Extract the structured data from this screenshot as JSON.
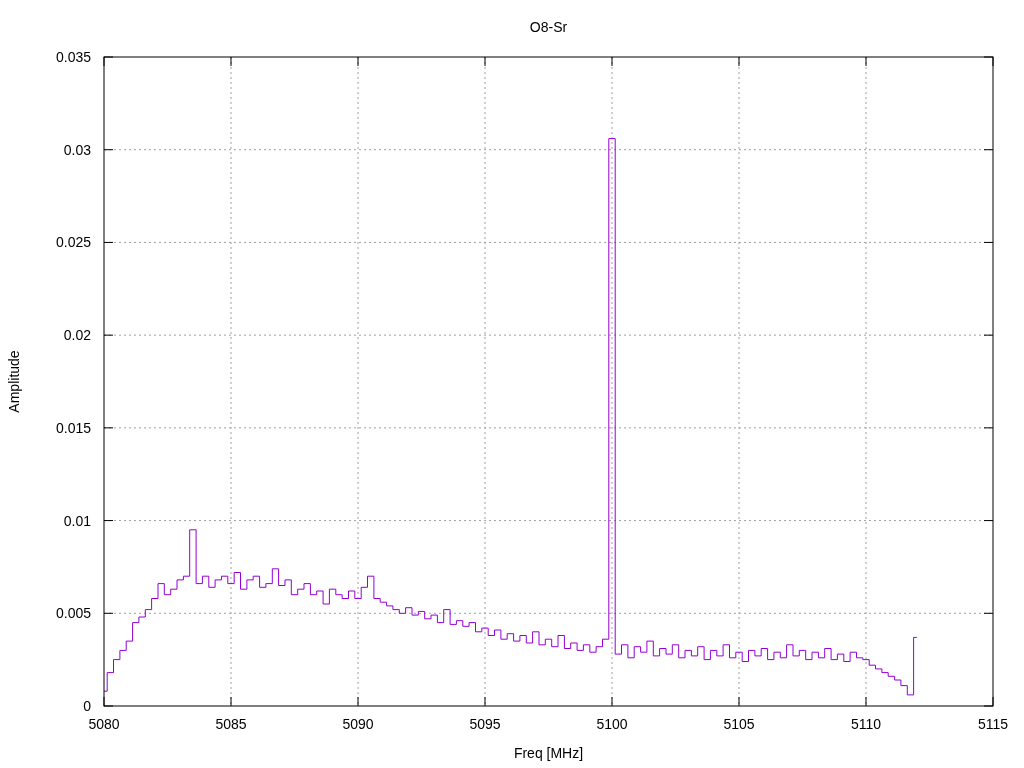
{
  "chart_data": {
    "type": "line",
    "title": "O8-Sr",
    "xlabel": "Freq [MHz]",
    "ylabel": "Amplitude",
    "x": [
      5080,
      5080.25,
      5080.5,
      5080.75,
      5081,
      5081.25,
      5081.5,
      5081.75,
      5082,
      5082.25,
      5082.5,
      5082.75,
      5083,
      5083.25,
      5083.5,
      5083.75,
      5084,
      5084.25,
      5084.5,
      5084.75,
      5085,
      5085.25,
      5085.5,
      5085.75,
      5086,
      5086.25,
      5086.5,
      5086.75,
      5087,
      5087.25,
      5087.5,
      5087.75,
      5088,
      5088.25,
      5088.5,
      5088.75,
      5089,
      5089.25,
      5089.5,
      5089.75,
      5090,
      5090.25,
      5090.5,
      5090.75,
      5091,
      5091.25,
      5091.5,
      5091.75,
      5092,
      5092.25,
      5092.5,
      5092.75,
      5093,
      5093.25,
      5093.5,
      5093.75,
      5094,
      5094.25,
      5094.5,
      5094.75,
      5095,
      5095.25,
      5095.5,
      5095.75,
      5096,
      5096.25,
      5096.5,
      5096.75,
      5097,
      5097.25,
      5097.5,
      5097.75,
      5098,
      5098.25,
      5098.5,
      5098.75,
      5099,
      5099.25,
      5099.5,
      5099.75,
      5100,
      5100.25,
      5100.5,
      5100.75,
      5101,
      5101.25,
      5101.5,
      5101.75,
      5102,
      5102.25,
      5102.5,
      5102.75,
      5103,
      5103.25,
      5103.5,
      5103.75,
      5104,
      5104.25,
      5104.5,
      5104.75,
      5105,
      5105.25,
      5105.5,
      5105.75,
      5106,
      5106.25,
      5106.5,
      5106.75,
      5107,
      5107.25,
      5107.5,
      5107.75,
      5108,
      5108.25,
      5108.5,
      5108.75,
      5109,
      5109.25,
      5109.5,
      5109.75,
      5110,
      5110.25,
      5110.5,
      5110.75,
      5111,
      5111.25,
      5111.5,
      5111.75,
      5112
    ],
    "series": [
      {
        "color": "#9400d3",
        "values": [
          0.0008,
          0.0018,
          0.0025,
          0.003,
          0.0035,
          0.0045,
          0.0048,
          0.0052,
          0.0058,
          0.0066,
          0.006,
          0.0063,
          0.0068,
          0.007,
          0.0095,
          0.0066,
          0.007,
          0.0064,
          0.0068,
          0.007,
          0.0066,
          0.0072,
          0.0063,
          0.0068,
          0.007,
          0.0064,
          0.0066,
          0.0074,
          0.0065,
          0.0068,
          0.006,
          0.0063,
          0.0066,
          0.006,
          0.0062,
          0.0055,
          0.0063,
          0.006,
          0.0058,
          0.0062,
          0.0058,
          0.0064,
          0.007,
          0.0058,
          0.0056,
          0.0054,
          0.0052,
          0.005,
          0.0053,
          0.0049,
          0.0051,
          0.0047,
          0.0049,
          0.0045,
          0.0052,
          0.0044,
          0.0046,
          0.0043,
          0.0045,
          0.004,
          0.0042,
          0.0038,
          0.0041,
          0.0036,
          0.0039,
          0.0035,
          0.0038,
          0.0034,
          0.004,
          0.0033,
          0.0036,
          0.0032,
          0.0038,
          0.0031,
          0.0034,
          0.003,
          0.0033,
          0.0029,
          0.0032,
          0.0036,
          0.0306,
          0.0028,
          0.0033,
          0.0026,
          0.0032,
          0.0029,
          0.0035,
          0.0027,
          0.0031,
          0.0028,
          0.0033,
          0.0026,
          0.003,
          0.0027,
          0.0032,
          0.0025,
          0.003,
          0.0027,
          0.0033,
          0.0026,
          0.0029,
          0.0024,
          0.003,
          0.0027,
          0.0031,
          0.0025,
          0.0029,
          0.0026,
          0.0033,
          0.0027,
          0.003,
          0.0025,
          0.0029,
          0.0026,
          0.0031,
          0.0025,
          0.0028,
          0.0024,
          0.0029,
          0.0026,
          0.0025,
          0.0022,
          0.002,
          0.0018,
          0.0016,
          0.0014,
          0.0011,
          0.0006,
          0.0037
        ]
      }
    ],
    "grid": true,
    "xlim": [
      5080,
      5115
    ],
    "ylim": [
      0,
      0.035
    ],
    "xticks": [
      5080,
      5085,
      5090,
      5095,
      5100,
      5105,
      5110,
      5115
    ],
    "yticks": [
      0,
      0.005,
      0.01,
      0.015,
      0.02,
      0.025,
      0.03,
      0.035
    ]
  }
}
